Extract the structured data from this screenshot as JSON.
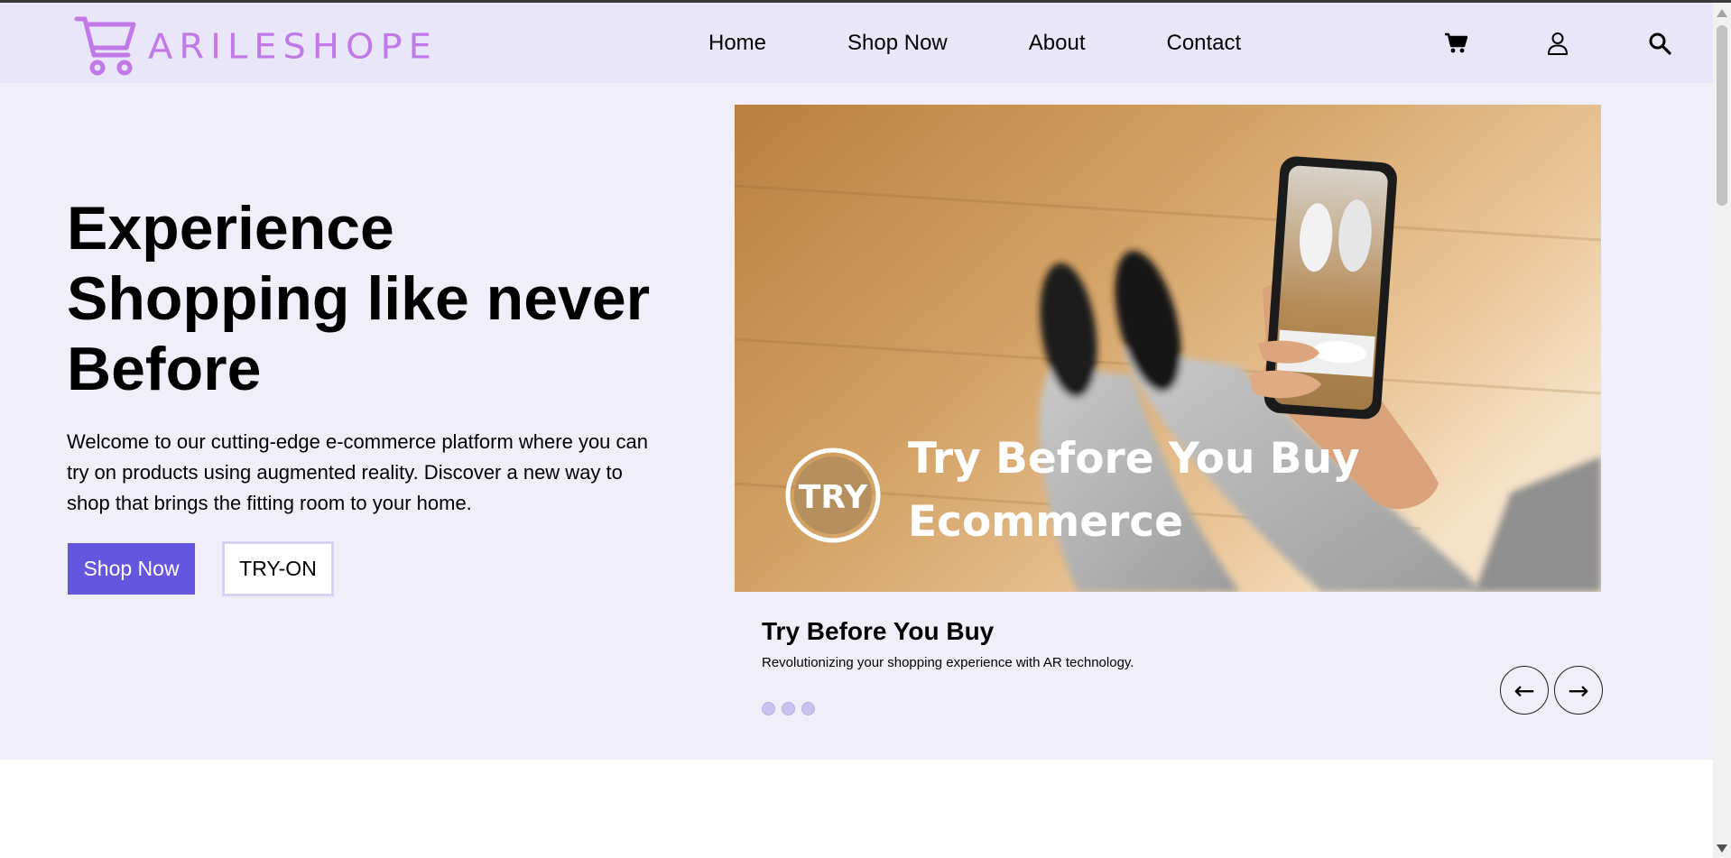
{
  "brand": {
    "name": "ARILESHOPE",
    "color": "#c179e9"
  },
  "nav": {
    "links": [
      "Home",
      "Shop Now",
      "About",
      "Contact"
    ],
    "icons": [
      "cart-icon",
      "user-icon",
      "search-icon"
    ]
  },
  "hero": {
    "title": "Experience Shopping like never Before",
    "description": "Welcome to our cutting-edge e-commerce platform where you can try on products using augmented reality. Discover a new way to shop that brings the fitting room to your home.",
    "primary_button": "Shop Now",
    "secondary_button": "TRY-ON",
    "accent_color": "#6556e0"
  },
  "slider": {
    "image": {
      "badge": "TRY",
      "headline_line1": "Try Before You Buy",
      "headline_line2": "Ecommerce"
    },
    "caption_title": "Try Before You Buy",
    "caption_text": "Revolutionizing your shopping experience with AR technology.",
    "dot_count": 3,
    "prev_label": "←",
    "next_label": "→"
  }
}
